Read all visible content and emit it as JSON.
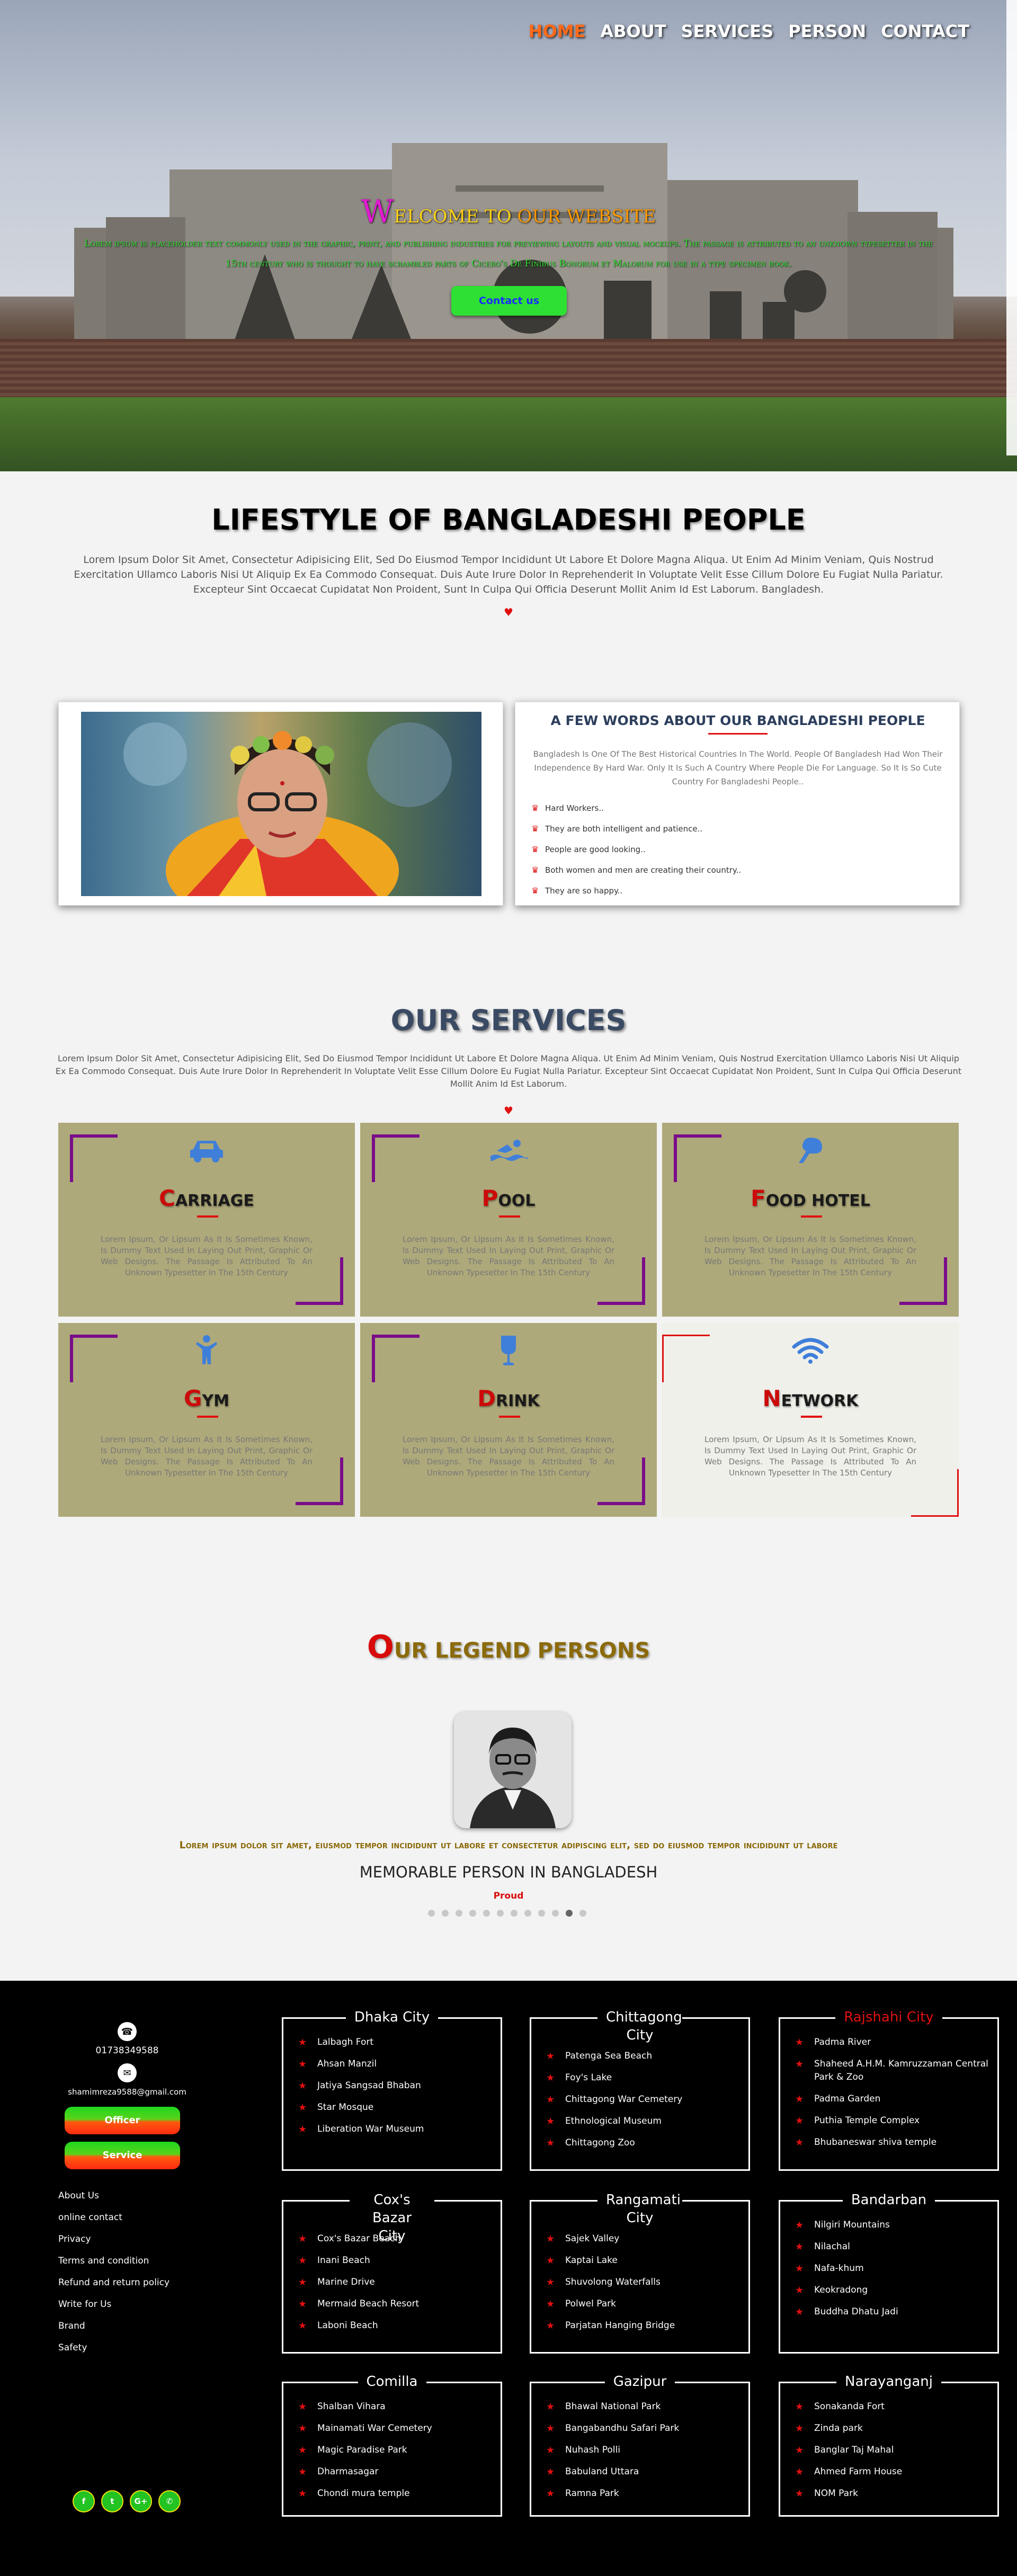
{
  "nav": [
    "HOME",
    "ABOUT",
    "SERVICES",
    "PERSON",
    "CONTACT"
  ],
  "hero": {
    "title_first": "W",
    "title_rest": "ELCOME TO ",
    "title_ours": "OUR WEBSITE",
    "para1": "Lorem ipsum is placeholder text commonly used in the graphic, print, and publishing industries for previewing layouts and visual mockups. The passage is attributed to an unknown typesetter in the",
    "para2": "15th century who is thought to have scrambled parts of Cicero's De Finibus Bonorum et Malorum for use in a type specimen book.",
    "button": "Contact us"
  },
  "lifestyle": {
    "title": "LIFESTYLE OF BANGLADESHI PEOPLE",
    "text": "Lorem Ipsum Dolor Sit Amet, Consectetur Adipisicing Elit, Sed Do Eiusmod Tempor Incididunt Ut Labore Et Dolore Magna Aliqua. Ut Enim Ad Minim Veniam, Quis Nostrud Exercitation Ullamco Laboris Nisi Ut Aliquip Ex Ea Commodo Consequat. Duis Aute Irure Dolor In Reprehenderit In Voluptate Velit Esse Cillum Dolore Eu Fugiat Nulla Pariatur. Excepteur Sint Occaecat Cupidatat Non Proident, Sunt In Culpa Qui Officia Deserunt Mollit Anim Id Est Laborum. Bangladesh.",
    "heart": "♥"
  },
  "about": {
    "title": "A FEW WORDS ABOUT OUR BANGLADESHI PEOPLE",
    "text": "Bangladesh Is One Of The Best Historical Countries In The World. People Of Bangladesh Had Won Their Independence By Hard War. Only It Is Such A Country Where People Die For Language. So It Is So Cute Country For Bangladeshi People..",
    "items": [
      "Hard Workers..",
      "They are both intelligent and patience..",
      "People are good looking..",
      "Both women and men are creating their country..",
      "They are so happy.."
    ]
  },
  "services": {
    "title": "OUR SERVICES",
    "text": "Lorem Ipsum Dolor Sit Amet, Consectetur Adipisicing Elit, Sed Do Eiusmod Tempor Incididunt Ut Labore Et Dolore Magna Aliqua. Ut Enim Ad Minim Veniam, Quis Nostrud Exercitation Ullamco Laboris Nisi Ut Aliquip Ex Ea Commodo Consequat. Duis Aute Irure Dolor In Reprehenderit In Voluptate Velit Esse Cillum Dolore Eu Fugiat Nulla Pariatur. Excepteur Sint Occaecat Cupidatat Non Proident, Sunt In Culpa Qui Officia Deserunt Mollit Anim Id Est Laborum.",
    "heart": "♥",
    "desc": "Lorem Ipsum, Or Lipsum As It Is Sometimes Known, Is Dummy Text Used In Laying Out Print, Graphic Or Web Designs. The Passage Is Attributed To An Unknown Typesetter In The 15th Century",
    "items": [
      {
        "first": "C",
        "rest": "ARRIAGE",
        "icon": "car-icon"
      },
      {
        "first": "P",
        "rest": "OOL",
        "icon": "swimmer-icon"
      },
      {
        "first": "F",
        "rest": "OOD HOTEL",
        "icon": "utensils-icon"
      },
      {
        "first": "G",
        "rest": "YM",
        "icon": "person-icon"
      },
      {
        "first": "D",
        "rest": "RINK",
        "icon": "glass-icon"
      },
      {
        "first": "N",
        "rest": "ETWORK",
        "icon": "wifi-icon"
      }
    ],
    "colors": {
      "card": "#aea97a",
      "corner": "#7a0c8a",
      "icon": "#3f7fd9",
      "accent": "#e01010"
    }
  },
  "legend": {
    "title_first": "O",
    "title_rest": "UR LEGEND PERSONS",
    "quote": "Lorem ipsum dolor sit amet, eiusmod tempor incididunt ut labore et consectetur adipiscing elit, sed do eiusmod tempor incididunt ut labore",
    "name": "MEMORABLE PERSON IN BANGLADESH",
    "role": "Proud",
    "dot_count": 12,
    "active_dot": 10
  },
  "footer": {
    "phone": "01738349588",
    "email": "shamimreza9588@gmail.com",
    "btn_officer": "Officer",
    "btn_service": "Service",
    "links": [
      "About Us",
      "online contact",
      "Privacy",
      "Terms and condition",
      "Refund and return policy",
      "Write for Us",
      "Brand",
      "Safety"
    ],
    "social": [
      "f",
      "t",
      "G+",
      "✆"
    ],
    "cities": [
      {
        "name": "Dhaka City",
        "places": [
          "Lalbagh Fort",
          "Ahsan Manzil",
          "Jatiya Sangsad Bhaban",
          "Star Mosque",
          "Liberation War Museum"
        ]
      },
      {
        "name": "Chittagong City",
        "places": [
          "Patenga Sea Beach",
          "Foy's Lake",
          "Chittagong War Cemetery",
          "Ethnological Museum",
          "Chittagong Zoo"
        ]
      },
      {
        "name": "Rajshahi City",
        "places": [
          "Padma River",
          "Shaheed A.H.M. Kamruzzaman Central Park & Zoo",
          "Padma Garden",
          "Puthia Temple Complex",
          "Bhubaneswar shiva temple"
        ]
      },
      {
        "name": "Cox's Bazar City",
        "places": [
          "Cox's Bazar Beach",
          "Inani Beach",
          "Marine Drive",
          "Mermaid Beach Resort",
          "Laboni Beach"
        ]
      },
      {
        "name": "Rangamati City",
        "places": [
          "Sajek Valley",
          "Kaptai Lake",
          "Shuvolong Waterfalls",
          "Polwel Park",
          "Parjatan Hanging Bridge"
        ]
      },
      {
        "name": "Bandarban",
        "places": [
          "Nilgiri Mountains",
          "Nilachal",
          "Nafa-khum",
          "Keokradong",
          "Buddha Dhatu Jadi"
        ]
      },
      {
        "name": "Comilla",
        "places": [
          "Shalban Vihara",
          "Mainamati War Cemetery",
          "Magic Paradise Park",
          "Dharmasagar",
          "Chondi mura temple"
        ]
      },
      {
        "name": "Gazipur",
        "places": [
          "Bhawal National Park",
          "Bangabandhu Safari Park",
          "Nuhash Polli",
          "Babuland Uttara",
          "Ramna Park"
        ]
      },
      {
        "name": "Narayanganj",
        "places": [
          "Sonakanda Fort",
          "Zinda park",
          "Banglar Taj Mahal",
          "Ahmed Farm House",
          "NOM Park"
        ]
      }
    ],
    "highlight_color": "#e01010"
  }
}
